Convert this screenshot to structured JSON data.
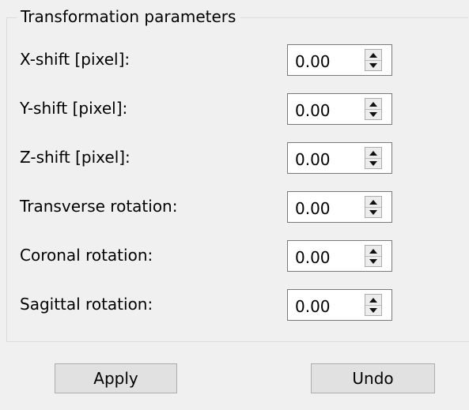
{
  "group": {
    "title": "Transformation parameters"
  },
  "params": [
    {
      "label": "X-shift [pixel]:",
      "value": "0.00"
    },
    {
      "label": "Y-shift [pixel]:",
      "value": "0.00"
    },
    {
      "label": "Z-shift [pixel]:",
      "value": "0.00"
    },
    {
      "label": "Transverse rotation:",
      "value": "0.00"
    },
    {
      "label": "Coronal rotation:",
      "value": "0.00"
    },
    {
      "label": "Sagittal rotation:",
      "value": "0.00"
    }
  ],
  "buttons": {
    "apply_label": "Apply",
    "undo_label": "Undo"
  },
  "icons": {
    "spin_up": "triangle-up-icon",
    "spin_down": "triangle-down-icon"
  }
}
